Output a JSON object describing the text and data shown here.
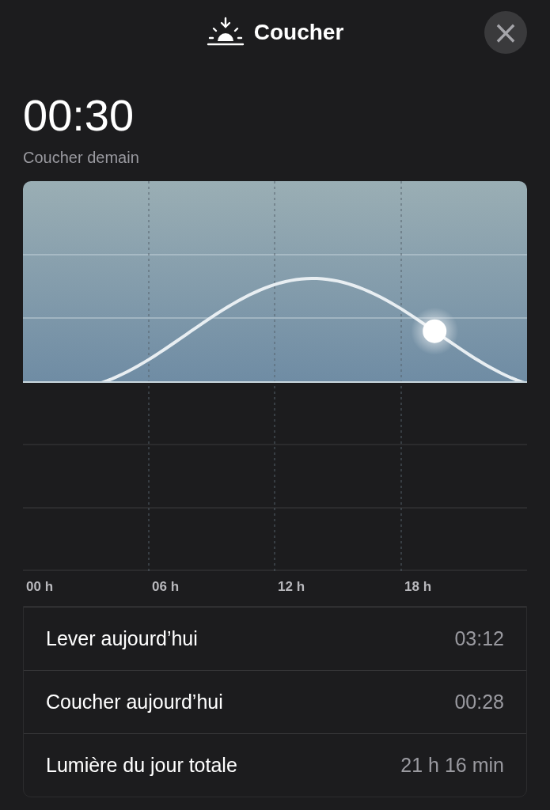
{
  "header": {
    "title": "Coucher",
    "close": "×"
  },
  "event": {
    "time": "00:30",
    "caption": "Coucher demain"
  },
  "chart": {
    "x_labels": [
      "00 h",
      "06 h",
      "12 h",
      "18 h"
    ]
  },
  "details": [
    {
      "label": "Lever aujourd’hui",
      "value": "03:12"
    },
    {
      "label": "Coucher aujourd’hui",
      "value": "00:28"
    },
    {
      "label": "Lumière du jour totale",
      "value": "21 h 16 min"
    }
  ]
}
